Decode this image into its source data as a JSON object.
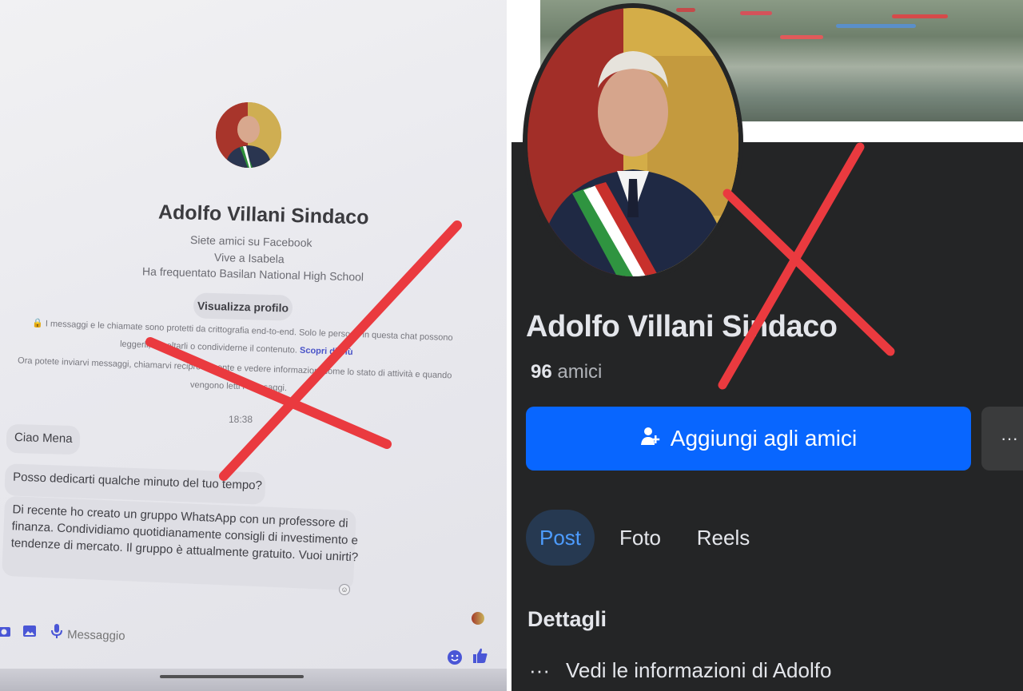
{
  "colors": {
    "fb_blue": "#0866ff",
    "fb_dark_bg": "#242526",
    "cross_red": "#ea3a3f",
    "messenger_accent": "#4a56d6"
  },
  "messenger": {
    "name": "Adolfo Villani Sindaco",
    "info": {
      "friends": "Siete amici su Facebook",
      "lives": "Vive a Isabela",
      "school": "Ha frequentato Basilan National High School"
    },
    "profile_button": "Visualizza profilo",
    "encryption_note": {
      "line1": "I messaggi e le chiamate sono protetti da crittografia end-to-end. Solo le persone in questa chat possono",
      "line2": "leggerli, ascoltarli o condividerne il contenuto.",
      "link": "Scopri di più"
    },
    "activity_note": {
      "line1": "Ora potete inviarvi messaggi, chiamarvi reciprocamente e vedere informazioni come lo stato di attività e quando",
      "line2": "vengono letti i messaggi."
    },
    "time": "18:38",
    "messages": [
      {
        "lines": [
          "Ciao Mena"
        ]
      },
      {
        "lines": [
          "Posso dedicarti qualche minuto del tuo tempo?"
        ]
      },
      {
        "lines": [
          "Di recente ho creato un gruppo WhatsApp con un professore di",
          "finanza. Condividiamo quotidianamente consigli di investimento e",
          "tendenze di mercato. Il gruppo è attualmente gratuito. Vuoi unirti?"
        ]
      }
    ],
    "composer_placeholder": "Messaggio",
    "icons": [
      "camera-icon",
      "image-icon",
      "microphone-icon",
      "emoji-icon",
      "thumbs-up-icon"
    ]
  },
  "facebook": {
    "name": "Adolfo Villani Sindaco",
    "friends_count": "96",
    "friends_label": "amici",
    "add_friend_button": "Aggiungi agli amici",
    "more_button": "···",
    "tabs": [
      {
        "label": "Post",
        "active": true
      },
      {
        "label": "Foto",
        "active": false
      },
      {
        "label": "Reels",
        "active": false
      }
    ],
    "details_title": "Dettagli",
    "details_row": "Vedi le informazioni di Adolfo",
    "details_icon": "···"
  }
}
